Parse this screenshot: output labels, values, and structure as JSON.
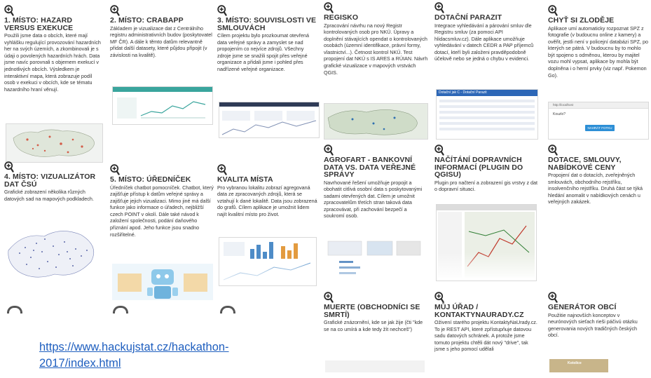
{
  "cards": [
    {
      "title": "1. místo: Hazard versus exekuce",
      "desc": "Použili jsme data o obcích, které mají vyhlášku regulující provozování hazardních her na svých územích, a zkombinovali je s údaji o povolených hazardních hrách. Data jsme navíc porovnali s objemem exekucí v jednotlivých obcích. Výsledkem je interaktivní mapa, která zobrazuje podíl osob v exekuci v obcích, kde se tématu hazardního hraní věnují."
    },
    {
      "title": "2. místo: CrabApp",
      "desc": "Základem je vizualizace dat z Centrálního registru administrativních budov (poskytovatel MF ČR). A dále k těmto datům relevantně přidat další datasety, které půjdou připojit (v závislosti na kvalitě)."
    },
    {
      "title": "3. místo: Souvislosti ve smlouvách",
      "desc": "Cílem projektu bylo prozkoumat otevřená data veřejné správy a zamyslet se nad propojením co nejvíce zdrojů. Všechny zdroje jsme se snažili spojit přes veřejné organizace a přidali jsme i pohled přes nadřízené veřejné organizace."
    },
    {
      "title": "Regisko",
      "desc": "Zpracování návrhu na nový Registr kontrolovaných osob pro NKÚ. Úpravy a doplnění stávajících opendat o kontrolovaných osobách (územní identifikace, právní formy, vlastnictví...). Četnost kontrol NKÚ. Test propojení dat NKÚ s IS ARES a RÚIAN. Návrh grafické vizualizace v mapových vrstvách QGIS."
    },
    {
      "title": "Dotační parazit",
      "desc": "Integrace vyhledávání a párování smluv dle Registru smluv (za pomoci API hlidacsmluv.cz). Dále aplikace umožňuje vyhledávání v datech CEDR a PAP příjemců dotací, kteří byli založeni pravděpodobně účelově nebo se jedná o chybu v evidenci."
    },
    {
      "title": "Chyť si zloděje",
      "desc": "Aplikace umí automaticky rozpoznat SPZ z fotografie (v budoucnu online z kamery) a ověřit, jestli není v policejní databázi SPZ, po kterých se pátrá. V budoucnu by to mohlo být spojeno s odměnou, kterou by majitel vozu mohl vypsat, aplikace by mohla být doplněna i o herní prvky (viz např. Pokemon Go)."
    },
    {
      "title": "4. místo: Vizualizátor dat ČSÚ",
      "desc": "Grafické zobrazení několika různých datových sad na mapových podkladech."
    },
    {
      "title": "5. místo: Úředníček",
      "desc": "Úředníček chatbot pomocníček. Chatbot, který zajišťuje přístup k datům veřejné správy a zajišťuje jejich vizualizaci. Mimo jiné má další funkce jako informace o úřadech, nejbližší czech POINT v okolí. Dále také návod k založení společnosti, podání daňového přiznání apod. Jeho funkce jsou snadno rozšiřitelné."
    },
    {
      "title": "Kvalita místa",
      "desc": "Pro vybranou lokalitu zobrazí agregovaná data ze zpracovaných zdrojů, která se vztahují k dané lokalitě. Data jsou zobrazená do grafů. Cílem aplikace je umožnit lidem najít kvalitní místo pro život."
    },
    {
      "title": "AgroFart - Bankovní data vs. data veřejné správy",
      "desc": "Navrhované řešení umožňuje propojit a obohatit citlivá osobní data s poskytovanými sadami otevřených dat. Cílem je umožnit zpracovatelům třetích stran taková data zpracovávat, při zachování bezpečí a soukromí osob."
    },
    {
      "title": "Načítání dopravních informací (plugin do QGISu)",
      "desc": "Plugin pro načtení a zobrazení gis vrstvy z dat o dopravní situaci."
    },
    {
      "title": "Dotace, smlouvy, nabídkové ceny",
      "desc": "Propojení dat o dotacích, zveřejněných smlouvách, obchodního rejstříku, insolvenčního rejstříku. Druhá část se týká hledání anomalit v nabídkových cenách u veřejných zakázek."
    },
    {
      "title": "Muerte (obchodníci se smrtí)",
      "desc": "Grafické znázornění, kde se jak žije (čti \"kde se na co umírá a kde tedy žít nechceš\")"
    },
    {
      "title": "Můj úřad / kontaktynaurady.cz",
      "desc": "Oživení starého projektu KontaktyNaUrady.cz. To je REST API, které zpřístupňuje datovou sadu datových schránek. A protože jsme tomuto projektu chtěli dát nový \"drive\", tak jsme s jeho pomocí udělali"
    },
    {
      "title": "Generátor obcí",
      "desc": "Použitie najnovších konceptov v neurónových sieťach rieši páčivú otázku generovania nových tradičných českých obcí."
    }
  ],
  "thumb_text": {
    "dotacni_header": "Dotační jak C - Dotační Parazit",
    "chyt_url": "http://localhost",
    "chyt_prompt": "Kouzlo?",
    "chyt_button": "NAHRÁT FOTKU",
    "generator_label": "Kotolice"
  },
  "footer_link": "https://www.hackujstat.cz/hackathon-2017/index.html",
  "colors": {
    "accent": "#1f5fbf",
    "title": "#333333",
    "text": "#333333"
  }
}
